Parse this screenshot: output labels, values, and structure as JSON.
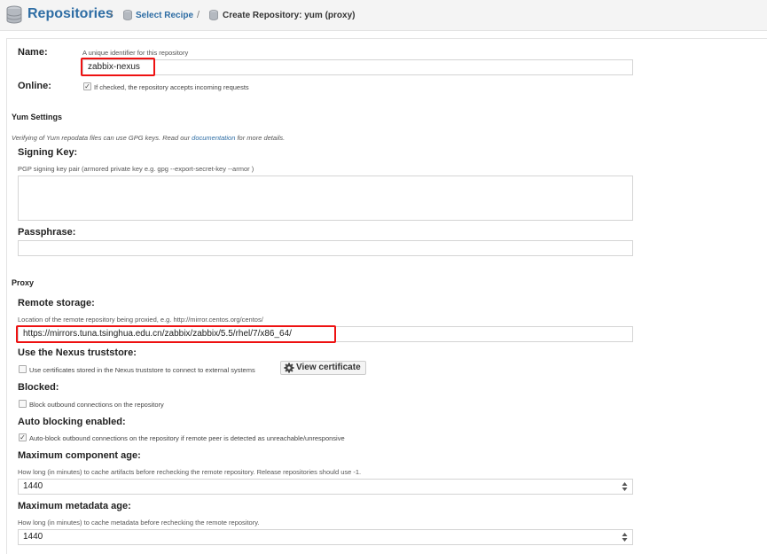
{
  "breadcrumb": {
    "root": "Repositories",
    "sep1": "/",
    "step": "Select Recipe",
    "sep2": "/",
    "current": "Create Repository: yum (proxy)"
  },
  "name": {
    "label": "Name:",
    "help": "A unique identifier for this repository",
    "value": "zabbix-nexus"
  },
  "online": {
    "label": "Online:",
    "checked": true,
    "text": "If checked, the repository accepts incoming requests"
  },
  "yum": {
    "title": "Yum Settings",
    "intro_pre": "Verifying of Yum repodata files can use GPG keys. Read our ",
    "intro_link": "documentation",
    "intro_post": " for more details.",
    "signing_label": "Signing Key:",
    "signing_help": "PGP signing key pair (armored private key e.g. gpg --export-secret-key --armor )",
    "passphrase_label": "Passphrase:"
  },
  "proxy": {
    "title": "Proxy",
    "remote_label": "Remote storage:",
    "remote_help": "Location of the remote repository being proxied, e.g. http://mirror.centos.org/centos/",
    "remote_value": "https://mirrors.tuna.tsinghua.edu.cn/zabbix/zabbix/5.5/rhel/7/x86_64/",
    "truststore_label": "Use the Nexus truststore:",
    "truststore_text": "Use certificates stored in the Nexus truststore to connect to external systems",
    "view_cert": "View certificate",
    "blocked_label": "Blocked:",
    "blocked_text": "Block outbound connections on the repository",
    "autoblock_label": "Auto blocking enabled:",
    "autoblock_text": "Auto-block outbound connections on the repository if remote peer is detected as unreachable/unresponsive",
    "max_component_label": "Maximum component age:",
    "max_component_help": "How long (in minutes) to cache artifacts before rechecking the remote repository. Release repositories should use -1.",
    "max_component_value": "1440",
    "max_metadata_label": "Maximum metadata age:",
    "max_metadata_help": "How long (in minutes) to cache metadata before rechecking the remote repository.",
    "max_metadata_value": "1440"
  },
  "checkmark": "✓",
  "colors": {
    "link": "#2e6da4",
    "highlight": "#e11111"
  },
  "icons": [
    "database-icon",
    "gear-icon",
    "spinner-arrows-icon"
  ]
}
